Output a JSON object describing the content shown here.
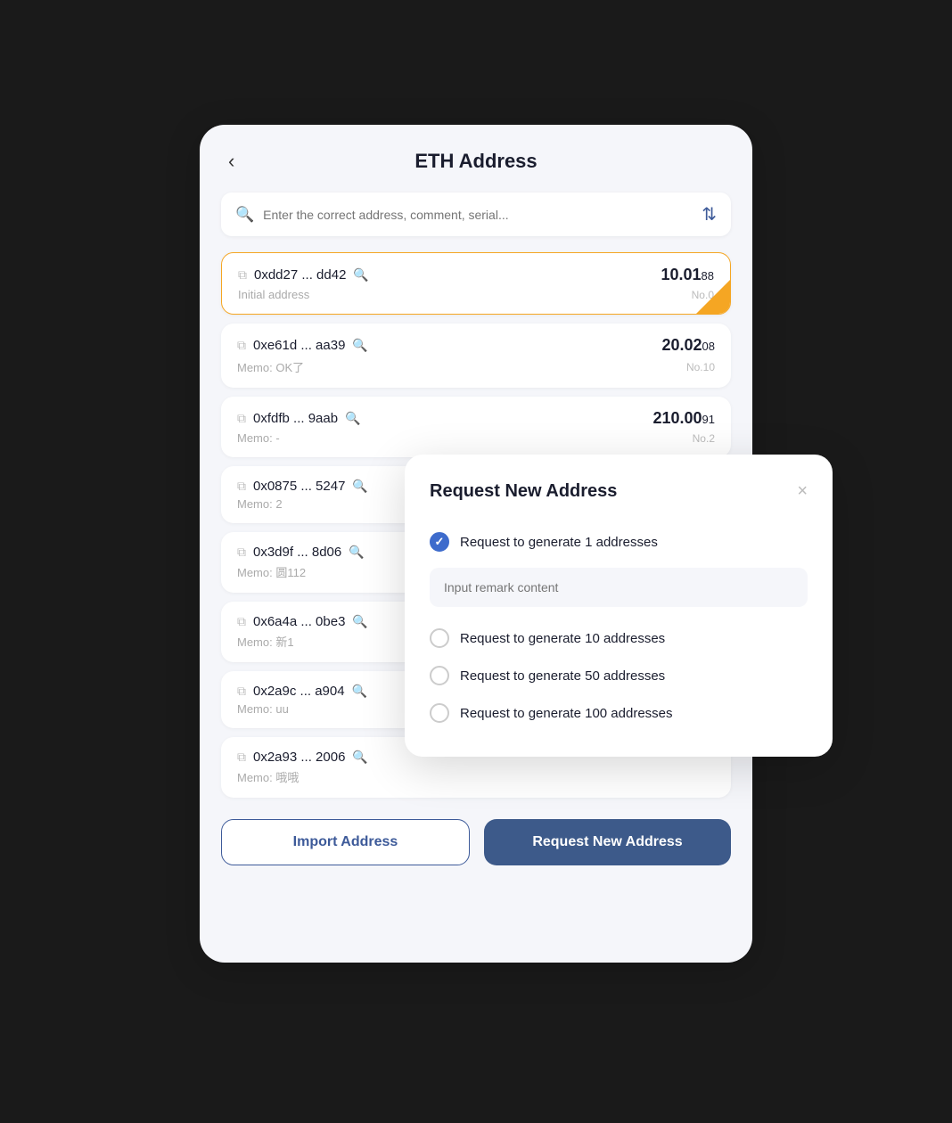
{
  "header": {
    "back_label": "‹",
    "title": "ETH Address"
  },
  "search": {
    "placeholder": "Enter the correct address, comment, serial..."
  },
  "filter_icon": "⇅",
  "addresses": [
    {
      "address": "0xdd27 ... dd42",
      "memo": "Initial address",
      "amount_main": "10.01",
      "amount_decimal": "88",
      "no": "No.0",
      "active": true
    },
    {
      "address": "0xe61d ... aa39",
      "memo": "Memo: OK了",
      "amount_main": "20.02",
      "amount_decimal": "08",
      "no": "No.10",
      "active": false
    },
    {
      "address": "0xfdfb ... 9aab",
      "memo": "Memo: -",
      "amount_main": "210.00",
      "amount_decimal": "91",
      "no": "No.2",
      "active": false
    },
    {
      "address": "0x0875 ... 5247",
      "memo": "Memo: 2",
      "amount_main": "",
      "amount_decimal": "",
      "no": "",
      "active": false
    },
    {
      "address": "0x3d9f ... 8d06",
      "memo": "Memo: 圆112",
      "amount_main": "",
      "amount_decimal": "",
      "no": "",
      "active": false
    },
    {
      "address": "0x6a4a ... 0be3",
      "memo": "Memo: 新1",
      "amount_main": "",
      "amount_decimal": "",
      "no": "",
      "active": false
    },
    {
      "address": "0x2a9c ... a904",
      "memo": "Memo: uu",
      "amount_main": "",
      "amount_decimal": "",
      "no": "",
      "active": false
    },
    {
      "address": "0x2a93 ... 2006",
      "memo": "Memo: 哦哦",
      "amount_main": "",
      "amount_decimal": "",
      "no": "",
      "active": false
    }
  ],
  "buttons": {
    "import_label": "Import Address",
    "request_label": "Request New Address"
  },
  "modal": {
    "title": "Request New Address",
    "close_label": "×",
    "remark_placeholder": "Input remark content",
    "options": [
      {
        "label": "Request to generate 1 addresses",
        "checked": true
      },
      {
        "label": "Request to generate 10 addresses",
        "checked": false
      },
      {
        "label": "Request to generate 50 addresses",
        "checked": false
      },
      {
        "label": "Request to generate 100 addresses",
        "checked": false
      }
    ]
  }
}
